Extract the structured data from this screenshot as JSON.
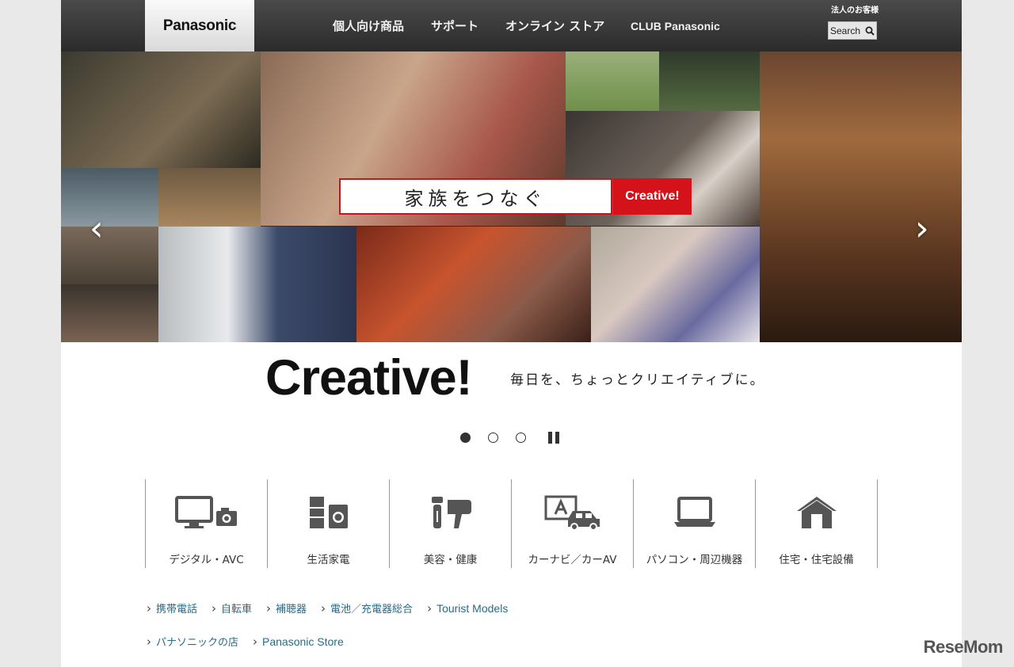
{
  "header": {
    "logo": "Panasonic",
    "nav": [
      "個人向け商品",
      "サポート",
      "オンライン ストア",
      "CLUB Panasonic"
    ],
    "business": "法人のお客様",
    "search_label": "Search"
  },
  "hero": {
    "banner_text": "家族をつなぐ",
    "banner_badge": "Creative!",
    "prev_arrow": "‹",
    "next_arrow": "›"
  },
  "tagline": {
    "brand": "Creative!",
    "slogan": "毎日を、ちょっとクリエイティブに。"
  },
  "categories": [
    {
      "label": "デジタル・AVC",
      "icon": "tv-camera-icon"
    },
    {
      "label": "生活家電",
      "icon": "appliances-icon"
    },
    {
      "label": "美容・健康",
      "icon": "beauty-icon"
    },
    {
      "label": "カーナビ／カーAV",
      "icon": "car-nav-icon"
    },
    {
      "label": "パソコン・周辺機器",
      "icon": "laptop-icon"
    },
    {
      "label": "住宅・住宅設備",
      "icon": "house-icon"
    }
  ],
  "links_row1": [
    "携帯電話",
    "自転車",
    "補聴器",
    "電池／充電器総合",
    "Tourist Models"
  ],
  "links_row2": [
    "パナソニックの店",
    "Panasonic Store"
  ],
  "watermark": "ReseMom"
}
